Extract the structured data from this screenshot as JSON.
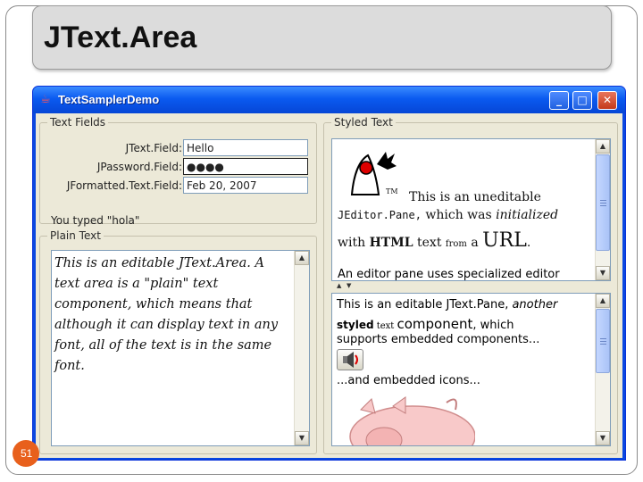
{
  "slide": {
    "title": "JText.Area",
    "page_number": "51"
  },
  "window": {
    "title": "TextSamplerDemo",
    "buttons": {
      "minimize": "_",
      "maximize": "□",
      "close": "✕"
    }
  },
  "text_fields_group": {
    "label": "Text Fields",
    "fields": [
      {
        "label": "JText.Field:",
        "value": "Hello"
      },
      {
        "label": "JPassword.Field:",
        "value": "●●●●"
      },
      {
        "label": "JFormatted.Text.Field:",
        "value": "Feb 20, 2007"
      }
    ],
    "typed_text": "You typed \"hola\""
  },
  "plain_text_group": {
    "label": "Plain Text",
    "text": "This is an editable JText.Area. A text area is a \"plain\" text component, which means that although it can display text in any font, all of the text is in the same font."
  },
  "styled_text_group": {
    "label": "Styled Text",
    "editor_pane": {
      "tm": "TM",
      "line1": "This is an uneditable",
      "line2_code": "JEditor.Pane,",
      "line2_rest": " which was ",
      "line2_italic": "initialized",
      "line3_with": "with ",
      "line3_html": "HTML",
      "line3_text": " text ",
      "line3_from": "from",
      "line3_a": " a ",
      "line3_url": "URL",
      "line3_period": ".",
      "line4": "An editor pane uses specialized editor"
    },
    "text_pane": {
      "line1_plain": "This is an editable JText.Pane, ",
      "line1_italic": "another",
      "line2_bold": "styled",
      "line2_small": " text ",
      "line2_large": "component",
      "line2_rest": ", which",
      "line3": "supports embedded components...",
      "line4": "...and embedded icons..."
    }
  }
}
